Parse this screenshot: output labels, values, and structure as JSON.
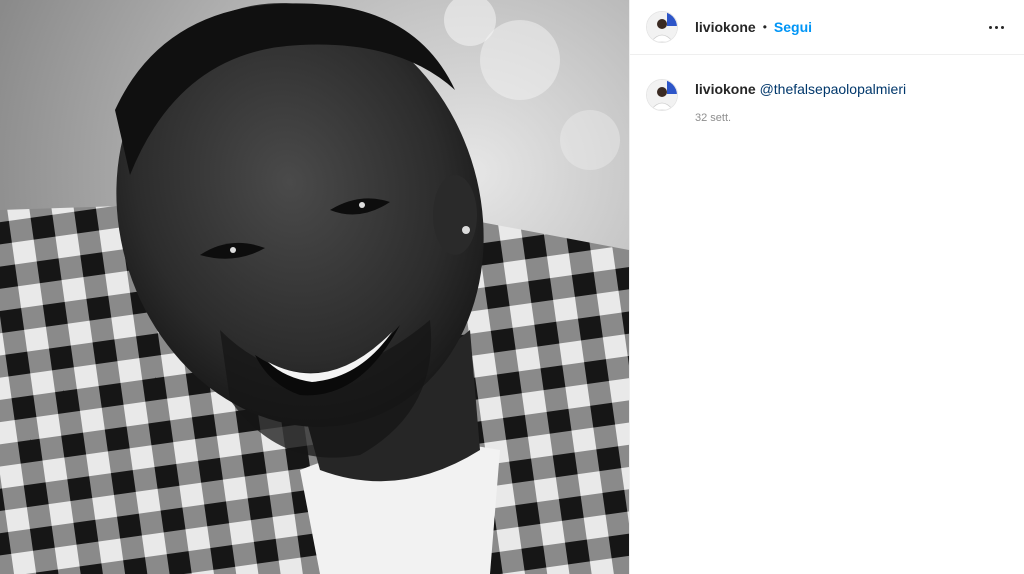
{
  "header": {
    "username": "liviokone",
    "separator": "•",
    "follow_label": "Segui",
    "more_icon": "more-horizontal-icon"
  },
  "caption": {
    "username": "liviokone",
    "mention": "@thefalsepaolopalmieri",
    "timestamp": "32 sett."
  },
  "colors": {
    "follow": "#0095f6",
    "mention": "#00376b",
    "text": "#262626",
    "muted": "#8e8e8e"
  }
}
